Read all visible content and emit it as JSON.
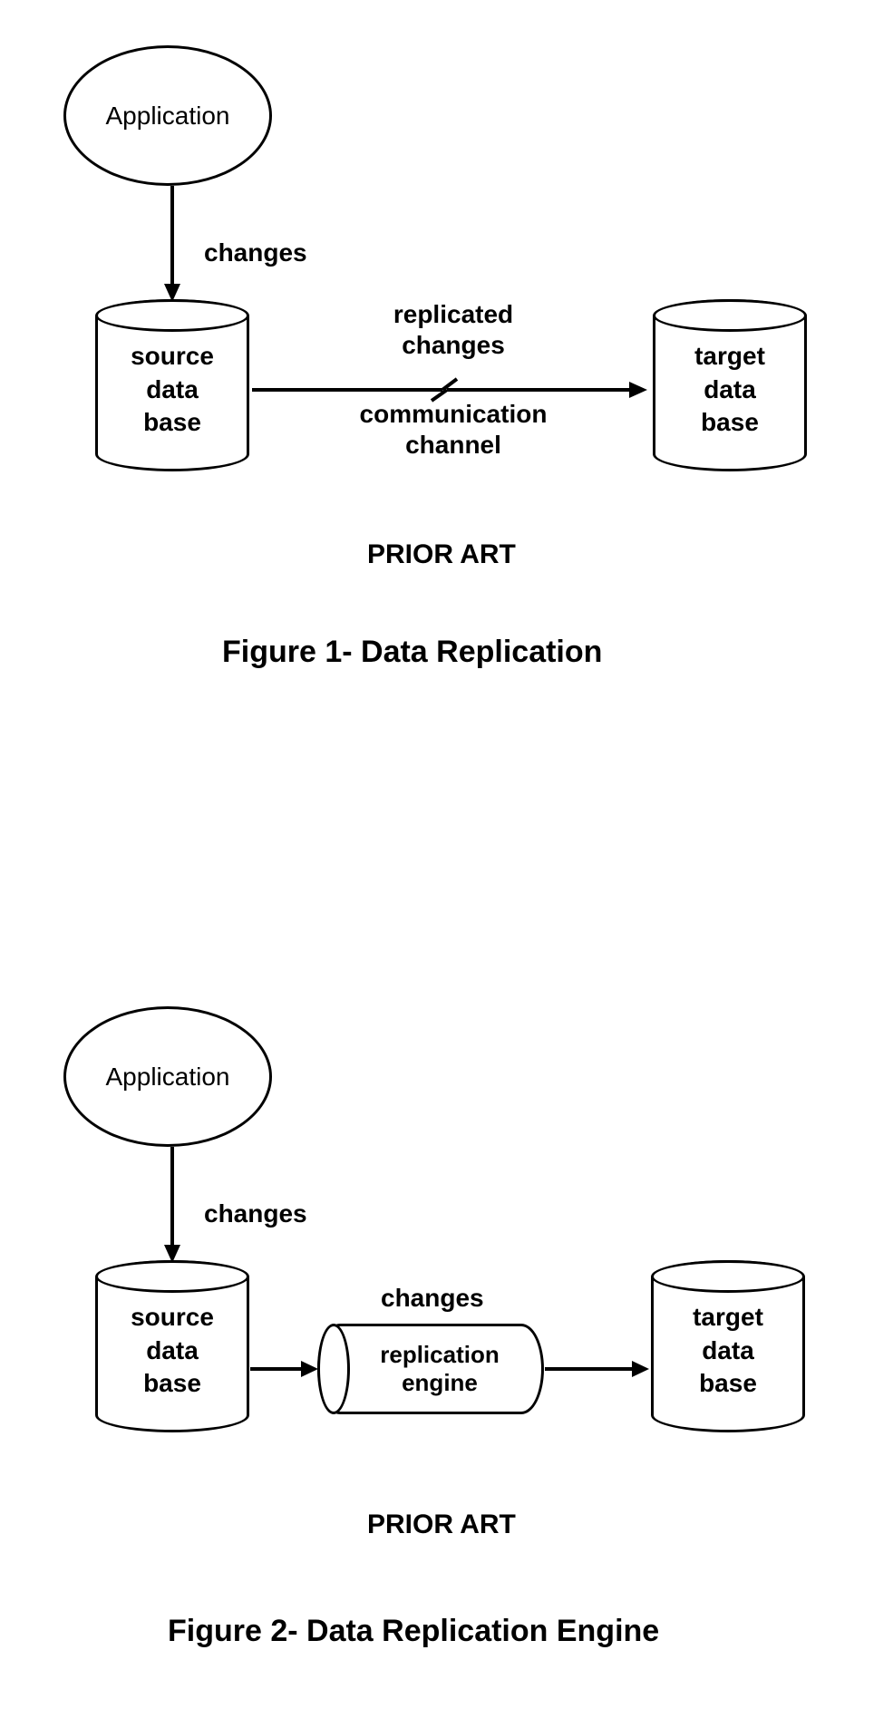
{
  "figure1": {
    "appLabel": "Application",
    "changesLabel": "changes",
    "sourceDb": "source\ndata\nbase",
    "replicatedChanges": "replicated\nchanges",
    "commChannel": "communication\nchannel",
    "targetDb": "target\ndata\nbase",
    "priorArt": "PRIOR ART",
    "title": "Figure 1- Data Replication"
  },
  "figure2": {
    "appLabel": "Application",
    "changesLabel": "changes",
    "sourceDb": "source\ndata\nbase",
    "changesLabel2": "changes",
    "replicationEngine": "replication\nengine",
    "targetDb": "target\ndata\nbase",
    "priorArt": "PRIOR ART",
    "title": "Figure 2- Data Replication Engine"
  }
}
